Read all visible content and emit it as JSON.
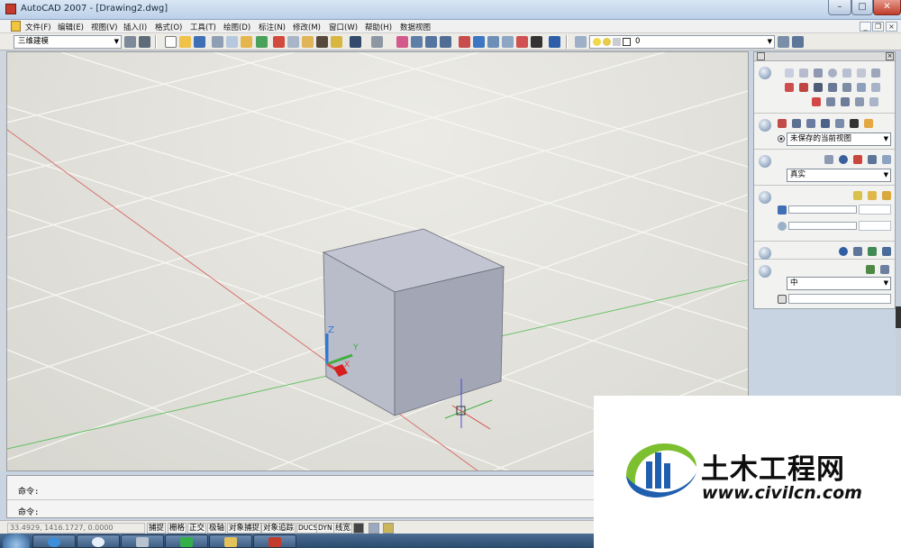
{
  "window": {
    "title": "AutoCAD 2007 - [Drawing2.dwg]",
    "minimize_label": "–",
    "maximize_label": "□",
    "close_label": "✕"
  },
  "menu": {
    "items": [
      {
        "label": "文件(F)"
      },
      {
        "label": "编辑(E)"
      },
      {
        "label": "视图(V)"
      },
      {
        "label": "插入(I)"
      },
      {
        "label": "格式(O)"
      },
      {
        "label": "工具(T)"
      },
      {
        "label": "绘图(D)"
      },
      {
        "label": "标注(N)"
      },
      {
        "label": "修改(M)"
      },
      {
        "label": "窗口(W)"
      },
      {
        "label": "帮助(H)"
      },
      {
        "label": "数据视图"
      }
    ],
    "mdi_min": "_",
    "mdi_restore": "❐",
    "mdi_close": "×"
  },
  "toolbar": {
    "workspace": "三维建模",
    "layer_value": "0"
  },
  "palette": {
    "view_combo": "未保存的当前视图",
    "visual_style_combo": "真实",
    "material_combo": "中"
  },
  "command": {
    "line1": "命令:",
    "line2": "命令:"
  },
  "status": {
    "coords": "33.4929,  1416.1727, 0.0000",
    "buttons": [
      "捕捉",
      "栅格",
      "正交",
      "极轴",
      "对象捕捉",
      "对象追踪",
      "DUCS",
      "DYN",
      "线宽"
    ]
  },
  "ucs": {
    "x": "X",
    "y": "Y",
    "z": "Z"
  },
  "watermark": {
    "title": "土木工程网",
    "url": "www.civilcn.com"
  },
  "colors": {
    "cube_light": "#b8bcc9",
    "cube_right": "#9ea3b2",
    "cube_top": "#c5c8d3",
    "axis_red": "#d64a4a",
    "axis_green": "#3fae3f",
    "accent_blue": "#2e67b6"
  },
  "icons": [
    "autocad-app-icon",
    "document-icon",
    "cube-icon",
    "ucs-icon",
    "crosshair-icon",
    "view-icon",
    "light-icon",
    "material-icon"
  ]
}
